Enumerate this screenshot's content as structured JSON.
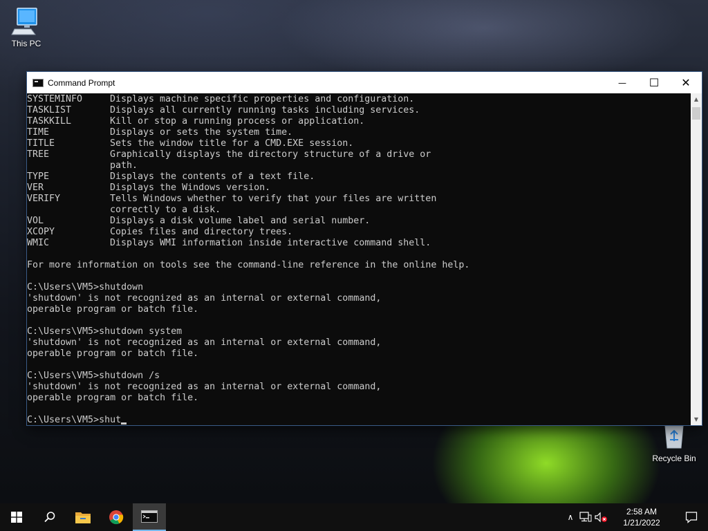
{
  "desktop": {
    "icons": [
      {
        "label": "This PC",
        "icon": "computer-icon"
      },
      {
        "label": "Recycle Bin",
        "icon": "recycle-bin-icon"
      }
    ]
  },
  "window": {
    "title": "Command Prompt",
    "controls": {
      "minimize": "—",
      "maximize": "☐",
      "close": "✕"
    }
  },
  "console": {
    "commands": [
      {
        "name": "SYSTEMINFO",
        "desc": "Displays machine specific properties and configuration."
      },
      {
        "name": "TASKLIST",
        "desc": "Displays all currently running tasks including services."
      },
      {
        "name": "TASKKILL",
        "desc": "Kill or stop a running process or application."
      },
      {
        "name": "TIME",
        "desc": "Displays or sets the system time."
      },
      {
        "name": "TITLE",
        "desc": "Sets the window title for a CMD.EXE session."
      },
      {
        "name": "TREE",
        "desc": "Graphically displays the directory structure of a drive or"
      },
      {
        "name": "",
        "desc": "path."
      },
      {
        "name": "TYPE",
        "desc": "Displays the contents of a text file."
      },
      {
        "name": "VER",
        "desc": "Displays the Windows version."
      },
      {
        "name": "VERIFY",
        "desc": "Tells Windows whether to verify that your files are written"
      },
      {
        "name": "",
        "desc": "correctly to a disk."
      },
      {
        "name": "VOL",
        "desc": "Displays a disk volume label and serial number."
      },
      {
        "name": "XCOPY",
        "desc": "Copies files and directory trees."
      },
      {
        "name": "WMIC",
        "desc": "Displays WMI information inside interactive command shell."
      }
    ],
    "lines": [
      "",
      "For more information on tools see the command-line reference in the online help.",
      "",
      "C:\\Users\\VM5>shutdown",
      "'shutdown' is not recognized as an internal or external command,",
      "operable program or batch file.",
      "",
      "C:\\Users\\VM5>shutdown system",
      "'shutdown' is not recognized as an internal or external command,",
      "operable program or batch file.",
      "",
      "C:\\Users\\VM5>shutdown /s",
      "'shutdown' is not recognized as an internal or external command,",
      "operable program or batch file.",
      ""
    ],
    "prompt": "C:\\Users\\VM5>",
    "current_input": "shut"
  },
  "taskbar": {
    "items": [
      {
        "icon": "windows-start-icon"
      },
      {
        "icon": "search-icon"
      },
      {
        "icon": "file-explorer-icon"
      },
      {
        "icon": "chrome-icon"
      },
      {
        "icon": "command-prompt-icon",
        "active": true
      }
    ],
    "tray": {
      "chevron": "∧",
      "time": "2:58 AM",
      "date": "1/21/2022"
    }
  },
  "colors": {
    "console_bg": "#0c0c0c",
    "console_text": "#cccccc",
    "taskbar_bg": "#101010",
    "active_accent": "#76b9ed"
  }
}
